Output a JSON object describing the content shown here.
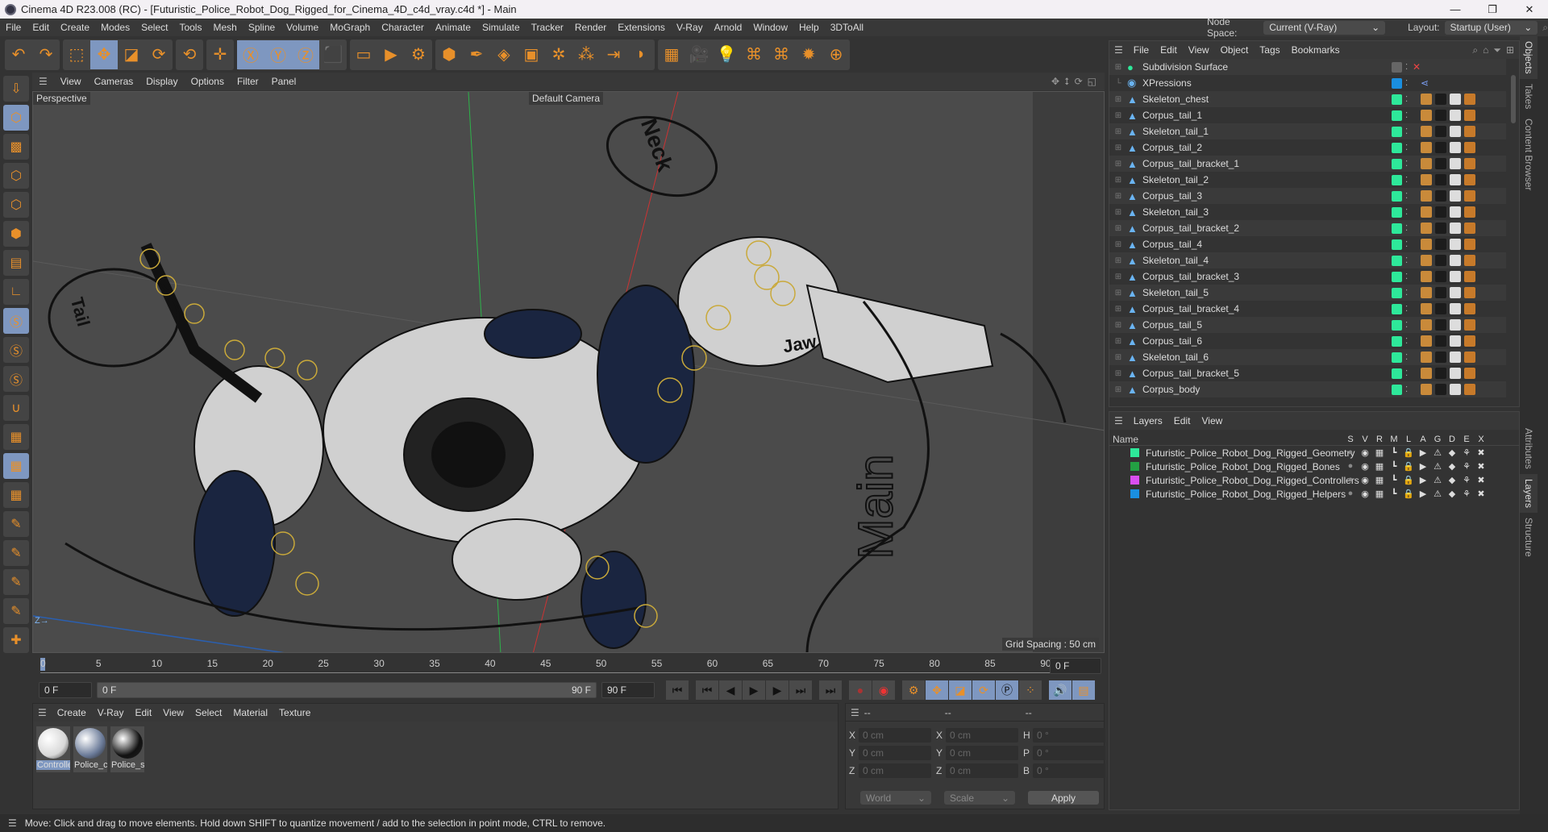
{
  "window": {
    "title": "Cinema 4D R23.008 (RC) - [Futuristic_Police_Robot_Dog_Rigged_for_Cinema_4D_c4d_vray.c4d *] - Main",
    "controls": [
      "—",
      "❐",
      "✕"
    ]
  },
  "menubar": {
    "items": [
      "File",
      "Edit",
      "Create",
      "Modes",
      "Select",
      "Tools",
      "Mesh",
      "Spline",
      "Volume",
      "MoGraph",
      "Character",
      "Animate",
      "Simulate",
      "Tracker",
      "Render",
      "Extensions",
      "V-Ray",
      "Arnold",
      "Window",
      "Help",
      "3DToAll"
    ],
    "node_space_label": "Node Space:",
    "node_space_value": "Current (V-Ray)",
    "layout_label": "Layout:",
    "layout_value": "Startup (User)"
  },
  "toolbar": {
    "groups": [
      [
        {
          "name": "undo",
          "glyph": "↶",
          "sel": false
        },
        {
          "name": "redo",
          "glyph": "↷",
          "sel": false
        }
      ],
      [
        {
          "name": "live-selection",
          "glyph": "⬚",
          "sel": false
        },
        {
          "name": "move",
          "glyph": "✥",
          "sel": true
        },
        {
          "name": "scale",
          "glyph": "◪",
          "sel": false
        },
        {
          "name": "rotate",
          "glyph": "⟳",
          "sel": false
        }
      ],
      [
        {
          "name": "psr",
          "glyph": "⟲",
          "sel": false
        }
      ],
      [
        {
          "name": "transform",
          "glyph": "✛",
          "sel": false
        }
      ],
      [
        {
          "name": "x-axis",
          "glyph": "Ⓧ",
          "sel": true
        },
        {
          "name": "y-axis",
          "glyph": "Ⓨ",
          "sel": true
        },
        {
          "name": "z-axis",
          "glyph": "Ⓩ",
          "sel": true
        },
        {
          "name": "coordinate-system",
          "glyph": "⬛",
          "sel": false
        }
      ],
      [
        {
          "name": "render-view",
          "glyph": "▭",
          "sel": false
        },
        {
          "name": "render-picture-viewer",
          "glyph": "▶",
          "sel": false
        },
        {
          "name": "render-settings",
          "glyph": "⚙",
          "sel": false
        }
      ],
      [
        {
          "name": "cube",
          "glyph": "⬢",
          "sel": false
        },
        {
          "name": "pen",
          "glyph": "✒",
          "sel": false
        },
        {
          "name": "subdivision-surface",
          "glyph": "◈",
          "sel": false
        },
        {
          "name": "extrude",
          "glyph": "▣",
          "sel": false
        },
        {
          "name": "mograph-cloner",
          "glyph": "✲",
          "sel": false
        },
        {
          "name": "array",
          "glyph": "⁂",
          "sel": false
        },
        {
          "name": "symmetry",
          "glyph": "⇥",
          "sel": false
        },
        {
          "name": "deformer",
          "glyph": "◗",
          "sel": false
        }
      ],
      [
        {
          "name": "floor",
          "glyph": "▦",
          "sel": false
        },
        {
          "name": "camera",
          "glyph": "🎥",
          "sel": false
        },
        {
          "name": "light",
          "glyph": "💡",
          "sel": false
        },
        {
          "name": "python-1",
          "glyph": "⌘",
          "sel": false
        },
        {
          "name": "python-2",
          "glyph": "⌘",
          "sel": false
        },
        {
          "name": "vray-settings",
          "glyph": "✹",
          "sel": false
        },
        {
          "name": "vray-globe",
          "glyph": "⊕",
          "sel": false
        }
      ]
    ]
  },
  "left_toolbar": [
    {
      "name": "make-editable",
      "sel": false,
      "glyph": "⇩"
    },
    {
      "name": "model-mode",
      "sel": true,
      "glyph": "⬡"
    },
    {
      "name": "texture-mode",
      "sel": false,
      "glyph": "▩"
    },
    {
      "name": "points-mode",
      "sel": false,
      "glyph": "⬡"
    },
    {
      "name": "edges-mode",
      "sel": false,
      "glyph": "⬡"
    },
    {
      "name": "polygons-mode",
      "sel": false,
      "glyph": "⬢"
    },
    {
      "name": "uv-mode",
      "sel": false,
      "glyph": "▤"
    },
    {
      "name": "axis-mode",
      "sel": false,
      "glyph": "∟"
    },
    {
      "name": "solo-off",
      "sel": true,
      "glyph": "Ⓢ"
    },
    {
      "name": "solo-single",
      "sel": false,
      "glyph": "Ⓢ"
    },
    {
      "name": "solo-hierarchy",
      "sel": false,
      "glyph": "Ⓢ"
    },
    {
      "name": "snap",
      "sel": false,
      "glyph": "∪"
    },
    {
      "name": "workplane",
      "sel": false,
      "glyph": "▦"
    },
    {
      "name": "locked-workplane",
      "sel": true,
      "glyph": "▦"
    },
    {
      "name": "workplane-align",
      "sel": false,
      "glyph": "▦"
    },
    {
      "name": "tweak-1",
      "sel": false,
      "glyph": "✎"
    },
    {
      "name": "tweak-p",
      "sel": false,
      "glyph": "✎"
    },
    {
      "name": "tweak-r",
      "sel": false,
      "glyph": "✎"
    },
    {
      "name": "tweak-o",
      "sel": false,
      "glyph": "✎"
    },
    {
      "name": "add-joint",
      "sel": false,
      "glyph": "✚"
    }
  ],
  "viewport": {
    "menu": [
      "View",
      "Cameras",
      "Display",
      "Options",
      "Filter",
      "Panel"
    ],
    "view_name": "Perspective",
    "camera": "Default Camera",
    "grid_spacing": "Grid Spacing : 50 cm",
    "labels": {
      "neck": "Neck",
      "main": "Main",
      "jaw": "Jaw",
      "tail": "Tail"
    }
  },
  "timeline": {
    "ticks": [
      "0",
      "5",
      "10",
      "15",
      "20",
      "25",
      "30",
      "35",
      "40",
      "45",
      "50",
      "55",
      "60",
      "65",
      "70",
      "75",
      "80",
      "85",
      "90"
    ],
    "current_frame": "0 F"
  },
  "transport": {
    "start": "0 F",
    "range_start": "0 F",
    "range_end": "90 F",
    "end": "90 F"
  },
  "materials": {
    "menu": [
      "Create",
      "V-Ray",
      "Edit",
      "View",
      "Select",
      "Material",
      "Texture"
    ],
    "items": [
      {
        "name": "Controlle",
        "color": "#d8d8d8"
      },
      {
        "name": "Police_cc",
        "color": "#6a7a98"
      },
      {
        "name": "Police_sk",
        "color": "#111"
      }
    ]
  },
  "coords": {
    "headers": [
      "--",
      "--",
      "--"
    ],
    "rows": [
      {
        "a": "X",
        "av": "0 cm",
        "b": "X",
        "bv": "0 cm",
        "c": "H",
        "cv": "0 °"
      },
      {
        "a": "Y",
        "av": "0 cm",
        "b": "Y",
        "bv": "0 cm",
        "c": "P",
        "cv": "0 °"
      },
      {
        "a": "Z",
        "av": "0 cm",
        "b": "Z",
        "bv": "0 cm",
        "c": "B",
        "cv": "0 °"
      }
    ],
    "mode": "World",
    "transform": "Scale",
    "apply": "Apply"
  },
  "objects": {
    "menu": [
      "File",
      "Edit",
      "View",
      "Object",
      "Tags",
      "Bookmarks"
    ],
    "items": [
      {
        "name": "Subdivision Surface",
        "color": "",
        "tags": false,
        "icon": "●"
      },
      {
        "name": "XPressions",
        "color": "#1a8fe0",
        "tags": false,
        "icon": "◉"
      },
      {
        "name": "Skeleton_chest",
        "color": "#2ee89a",
        "tags": true,
        "icon": "▲"
      },
      {
        "name": "Corpus_tail_1",
        "color": "#2ee89a",
        "tags": true,
        "icon": "▲"
      },
      {
        "name": "Skeleton_tail_1",
        "color": "#2ee89a",
        "tags": true,
        "icon": "▲"
      },
      {
        "name": "Corpus_tail_2",
        "color": "#2ee89a",
        "tags": true,
        "icon": "▲"
      },
      {
        "name": "Corpus_tail_bracket_1",
        "color": "#2ee89a",
        "tags": true,
        "icon": "▲"
      },
      {
        "name": "Skeleton_tail_2",
        "color": "#2ee89a",
        "tags": true,
        "icon": "▲"
      },
      {
        "name": "Corpus_tail_3",
        "color": "#2ee89a",
        "tags": true,
        "icon": "▲"
      },
      {
        "name": "Skeleton_tail_3",
        "color": "#2ee89a",
        "tags": true,
        "icon": "▲"
      },
      {
        "name": "Corpus_tail_bracket_2",
        "color": "#2ee89a",
        "tags": true,
        "icon": "▲"
      },
      {
        "name": "Corpus_tail_4",
        "color": "#2ee89a",
        "tags": true,
        "icon": "▲"
      },
      {
        "name": "Skeleton_tail_4",
        "color": "#2ee89a",
        "tags": true,
        "icon": "▲"
      },
      {
        "name": "Corpus_tail_bracket_3",
        "color": "#2ee89a",
        "tags": true,
        "icon": "▲"
      },
      {
        "name": "Skeleton_tail_5",
        "color": "#2ee89a",
        "tags": true,
        "icon": "▲"
      },
      {
        "name": "Corpus_tail_bracket_4",
        "color": "#2ee89a",
        "tags": true,
        "icon": "▲"
      },
      {
        "name": "Corpus_tail_5",
        "color": "#2ee89a",
        "tags": true,
        "icon": "▲"
      },
      {
        "name": "Corpus_tail_6",
        "color": "#2ee89a",
        "tags": true,
        "icon": "▲"
      },
      {
        "name": "Skeleton_tail_6",
        "color": "#2ee89a",
        "tags": true,
        "icon": "▲"
      },
      {
        "name": "Corpus_tail_bracket_5",
        "color": "#2ee89a",
        "tags": true,
        "icon": "▲"
      },
      {
        "name": "Corpus_body",
        "color": "#2ee89a",
        "tags": true,
        "icon": "▲"
      }
    ]
  },
  "layers": {
    "menu": [
      "Layers",
      "Edit",
      "View"
    ],
    "name_header": "Name",
    "flags": [
      "S",
      "V",
      "R",
      "M",
      "L",
      "A",
      "G",
      "D",
      "E",
      "X"
    ],
    "items": [
      {
        "name": "Futuristic_Police_Robot_Dog_Rigged_Geometry",
        "color": "#2ee89a"
      },
      {
        "name": "Futuristic_Police_Robot_Dog_Rigged_Bones",
        "color": "#23a043"
      },
      {
        "name": "Futuristic_Police_Robot_Dog_Rigged_Controllers",
        "color": "#d94ef0"
      },
      {
        "name": "Futuristic_Police_Robot_Dog_Rigged_Helpers",
        "color": "#1a8fe0"
      }
    ]
  },
  "right_tabs": {
    "top": [
      "Objects",
      "Takes",
      "Content Browser"
    ],
    "bottom": [
      "Attributes",
      "Layers",
      "Structure"
    ]
  },
  "status": "Move: Click and drag to move elements. Hold down SHIFT to quantize movement / add to the selection in point mode, CTRL to remove."
}
